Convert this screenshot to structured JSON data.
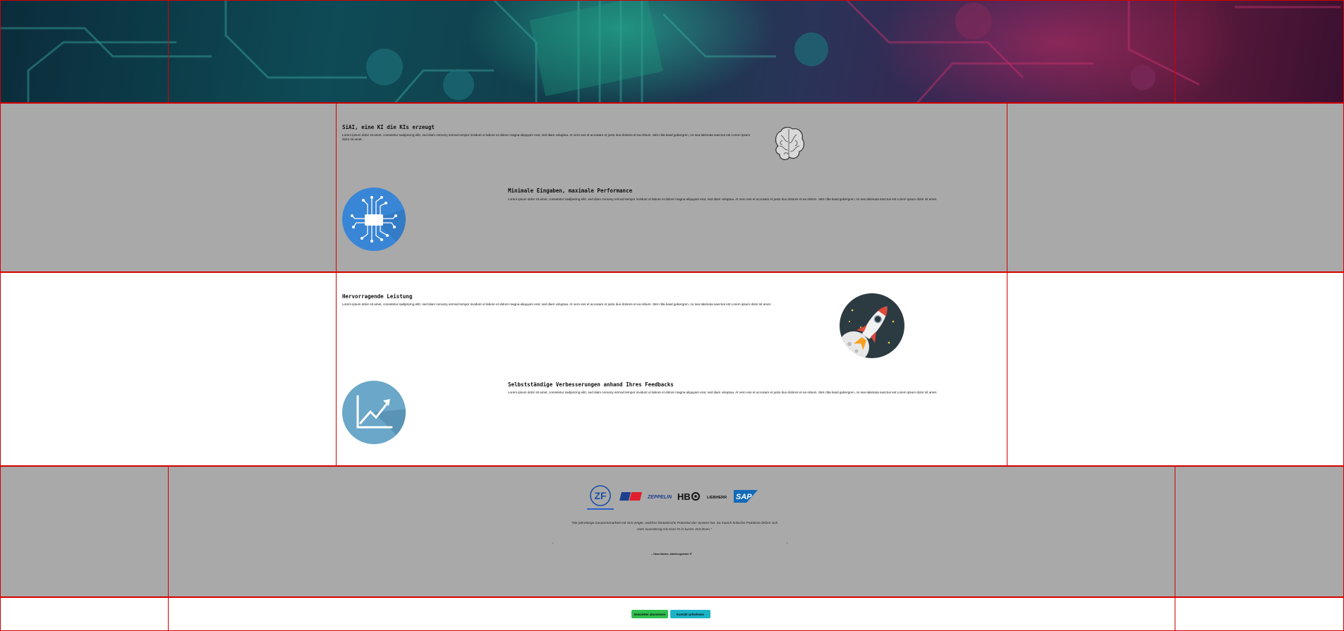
{
  "features": [
    {
      "title": "SiAI, eine KI die KIs erzeugt",
      "text": "Lorem ipsum dolor sit amet, consetetur sadipscing elitr, sed diam nonumy eirmod tempor invidunt ut labore et dolore magna aliquyam erat, sed diam voluptua. At vero eos et accusam et justo duo dolores et ea rebum. Stet clita kasd gubergren, no sea takimata sanctus est Lorem ipsum dolor sit amet.",
      "icon": "brain-icon"
    },
    {
      "title": "Minimale Eingaben, maximale Performance",
      "text": "Lorem ipsum dolor sit amet, consetetur sadipscing elitr, sed diam nonumy eirmod tempor invidunt ut labore et dolore magna aliquyam erat, sed diam voluptua. At vero eos et accusam et justo duo dolores et ea rebum. Stet clita kasd gubergren, no sea takimata sanctus est Lorem ipsum dolor sit amet.",
      "icon": "chip-icon"
    },
    {
      "title": "Hervorragende Leistung",
      "text": "Lorem ipsum dolor sit amet, consetetur sadipscing elitr, sed diam nonumy eirmod tempor invidunt ut labore et dolore magna aliquyam erat, sed diam voluptua. At vero eos et accusam et justo duo dolores et ea rebum. Stet clita kasd gubergren, no sea takimata sanctus est Lorem ipsum dolor sit amet.",
      "icon": "rocket-icon"
    },
    {
      "title": "Selbstständige Verbesserungen anhand Ihres Feedbacks",
      "text": "Lorem ipsum dolor sit amet, consetetur sadipscing elitr, sed diam nonumy eirmod tempor invidunt ut labore et dolore magna aliquyam erat, sed diam voluptua. At vero eos et accusam et justo duo dolores et ea rebum. Stet clita kasd gubergren, no sea takimata sanctus est Lorem ipsum dolor sit amet.",
      "icon": "growth-chart-icon"
    }
  ],
  "testimonials": {
    "logos": [
      {
        "name": "ZF",
        "icon": "zf-logo-icon",
        "active": true
      },
      {
        "name": "DB",
        "icon": "db-logo-icon"
      },
      {
        "name": "ZEPPELIN",
        "icon": "zeppelin-logo-icon"
      },
      {
        "name": "HBO",
        "icon": "hbo-logo-icon"
      },
      {
        "name": "LIEBHERR",
        "icon": "liebherr-logo-icon"
      },
      {
        "name": "SAP",
        "icon": "sap-logo-icon"
      }
    ],
    "quote": "\"Die jahrelange Zusammenarbeit mit SiAI zeigte, welches fantastische Potential das System hat. So manch kritische Probleme ließen sich stets zuverlässig mit einer KI in kurzer Zeit lösen.\"",
    "author": "– Hans Muster, Abteilungsleiter IT",
    "prev_tick": "‹",
    "next_tick": "›"
  },
  "buttons": {
    "primary_label": "Newsletter abonnieren",
    "secondary_label": "Kontakt aufnehmen"
  },
  "colors": {
    "border_red": "#d40000",
    "section_gray": "#a9a9a9",
    "button_green": "#2fbf4f",
    "button_teal": "#1db3c7"
  }
}
